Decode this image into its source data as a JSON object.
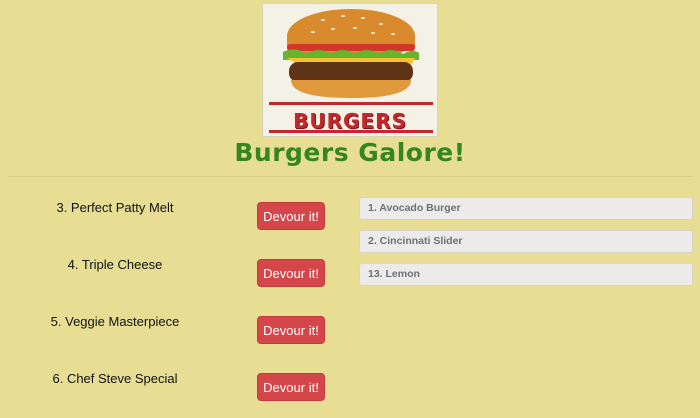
{
  "logo": {
    "text": "BURGERS"
  },
  "page_title": "Burgers Galore!",
  "uneaten": [
    {
      "name": "3. Perfect Patty Melt",
      "button": "Devour it!"
    },
    {
      "name": "4. Triple Cheese",
      "button": "Devour it!"
    },
    {
      "name": "5. Veggie Masterpiece",
      "button": "Devour it!"
    },
    {
      "name": "6. Chef Steve Special",
      "button": "Devour it!"
    }
  ],
  "devoured": [
    {
      "name": "1. Avocado Burger"
    },
    {
      "name": "2. Cincinnati Slider"
    },
    {
      "name": "13. Lemon"
    }
  ],
  "colors": {
    "background": "#e7de94",
    "title": "#35861e",
    "button": "#d5464a"
  }
}
